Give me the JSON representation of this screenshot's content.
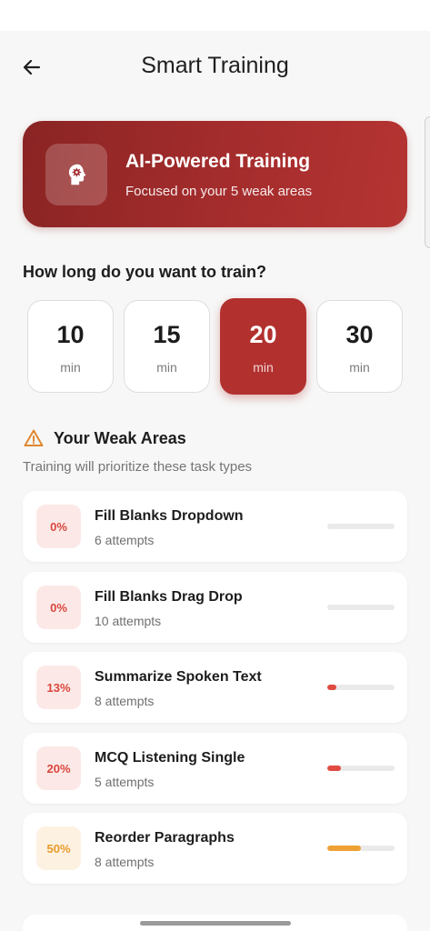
{
  "header": {
    "title": "Smart Training"
  },
  "hero": {
    "title": "AI-Powered Training",
    "subtitle": "Focused on your 5 weak areas"
  },
  "duration": {
    "question": "How long do you want to train?",
    "selected": "20",
    "options": [
      {
        "value": "10",
        "unit": "min"
      },
      {
        "value": "15",
        "unit": "min"
      },
      {
        "value": "20",
        "unit": "min"
      },
      {
        "value": "30",
        "unit": "min"
      }
    ]
  },
  "weak_areas": {
    "title": "Your Weak Areas",
    "subtitle": "Training will prioritize these task types",
    "items": [
      {
        "percent_label": "0%",
        "name": "Fill Blanks Dropdown",
        "attempts": "6 attempts",
        "score": 0
      },
      {
        "percent_label": "0%",
        "name": "Fill Blanks Drag Drop",
        "attempts": "10 attempts",
        "score": 0
      },
      {
        "percent_label": "13%",
        "name": "Summarize Spoken Text",
        "attempts": "8 attempts",
        "score": 13
      },
      {
        "percent_label": "20%",
        "name": "MCQ Listening Single",
        "attempts": "5 attempts",
        "score": 20
      },
      {
        "percent_label": "50%",
        "name": "Reorder Paragraphs",
        "attempts": "8 attempts",
        "score": 50
      }
    ]
  },
  "colors": {
    "accent": "#b2312f",
    "low_score": "#e04a40",
    "mid_score": "#eea235",
    "warning_icon": "#e0872f"
  },
  "icons": {
    "back": "arrow-left-icon",
    "hero": "brain-head-icon",
    "warning": "warning-triangle-icon"
  }
}
